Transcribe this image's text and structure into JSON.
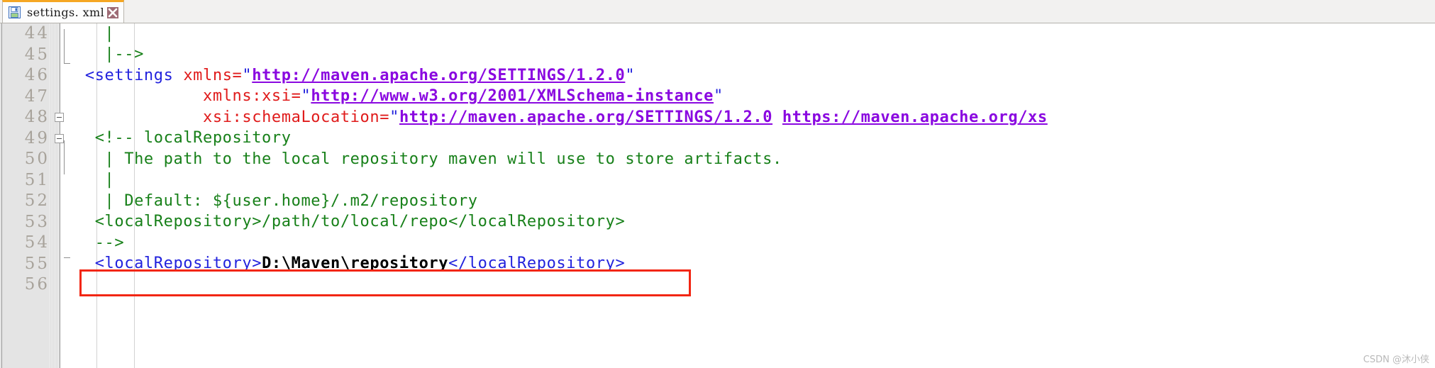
{
  "window": {
    "tab": {
      "title": "settings. xml",
      "save_icon": "floppy-disk-icon",
      "close_icon": "close-x-icon",
      "accent_color": "#f5a623"
    }
  },
  "editor": {
    "first_line": 44,
    "last_line": 56,
    "colors": {
      "comment": "#178019",
      "tag": "#2222dd",
      "attribute": "#e01b1b",
      "link": "#8a08e0",
      "text": "#000000",
      "gutter_bg": "#e4e4e4",
      "lineno": "#a8a39b",
      "highlight_box": "#f22613"
    },
    "lines": [
      {
        "number": "44",
        "fold": false,
        "tokens": [
          {
            "t": "   |",
            "c": "comment"
          }
        ]
      },
      {
        "number": "45",
        "fold": false,
        "tokens": [
          {
            "t": "   |-->",
            "c": "comment"
          }
        ]
      },
      {
        "number": "46",
        "fold": false,
        "tokens": [
          {
            "t": " <settings",
            "c": "tag"
          },
          {
            "t": " ",
            "c": "plain"
          },
          {
            "t": "xmlns",
            "c": "attr"
          },
          {
            "t": "=",
            "c": "attr"
          },
          {
            "t": "\"",
            "c": "str"
          },
          {
            "t": "http://maven.apache.org/SETTINGS/1.2.0",
            "c": "link"
          },
          {
            "t": "\"",
            "c": "str"
          }
        ]
      },
      {
        "number": "47",
        "fold": false,
        "tokens": [
          {
            "t": "             ",
            "c": "plain"
          },
          {
            "t": "xmlns:xsi",
            "c": "attr"
          },
          {
            "t": "=",
            "c": "attr"
          },
          {
            "t": "\"",
            "c": "str"
          },
          {
            "t": "http://www.w3.org/2001/XMLSchema-instance",
            "c": "link"
          },
          {
            "t": "\"",
            "c": "str"
          }
        ]
      },
      {
        "number": "48",
        "fold": true,
        "tokens": [
          {
            "t": "             ",
            "c": "plain"
          },
          {
            "t": "xsi:schemaLocation",
            "c": "attr"
          },
          {
            "t": "=",
            "c": "attr"
          },
          {
            "t": "\"",
            "c": "str"
          },
          {
            "t": "http://maven.apache.org/SETTINGS/1.2.0",
            "c": "link"
          },
          {
            "t": " ",
            "c": "plain"
          },
          {
            "t": "https://maven.apache.org/xs",
            "c": "link"
          }
        ]
      },
      {
        "number": "49",
        "fold": true,
        "tokens": [
          {
            "t": "  <!-- localRepository",
            "c": "comment"
          }
        ]
      },
      {
        "number": "50",
        "fold": false,
        "tokens": [
          {
            "t": "   | The path to the local repository maven will use to store artifacts.",
            "c": "comment"
          }
        ]
      },
      {
        "number": "51",
        "fold": false,
        "tokens": [
          {
            "t": "   |",
            "c": "comment"
          }
        ]
      },
      {
        "number": "52",
        "fold": false,
        "tokens": [
          {
            "t": "   | Default: ${user.home}/.m2/repository",
            "c": "comment"
          }
        ]
      },
      {
        "number": "53",
        "fold": false,
        "tokens": [
          {
            "t": "  <localRepository>/path/to/local/repo</localRepository>",
            "c": "comment"
          }
        ]
      },
      {
        "number": "54",
        "fold": false,
        "tokens": [
          {
            "t": "  -->",
            "c": "comment"
          }
        ]
      },
      {
        "number": "55",
        "fold": false,
        "highlighted": true,
        "tokens": [
          {
            "t": "  <localRepository>",
            "c": "tag"
          },
          {
            "t": "D:\\Maven\\repository",
            "c": "text"
          },
          {
            "t": "</localRepository>",
            "c": "tag"
          }
        ]
      },
      {
        "number": "56",
        "fold": false,
        "tokens": []
      }
    ]
  },
  "watermark": "CSDN @沐小侠"
}
